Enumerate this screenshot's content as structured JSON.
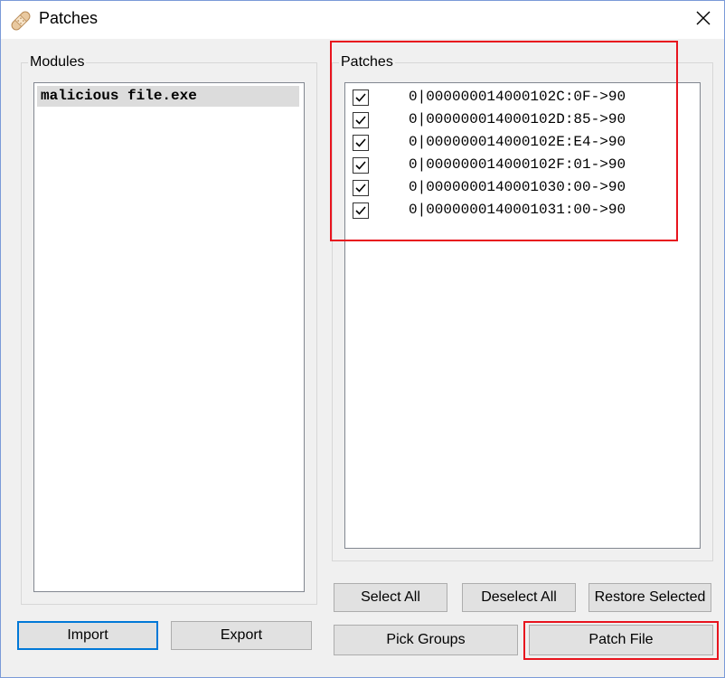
{
  "window": {
    "title": "Patches",
    "title_icon": "bandage-icon",
    "close_icon": "close-icon"
  },
  "modules": {
    "label": "Modules",
    "items": [
      "malicious file.exe"
    ]
  },
  "patches": {
    "label": "Patches",
    "items": [
      {
        "checked": true,
        "text": "0|000000014000102C:0F->90"
      },
      {
        "checked": true,
        "text": "0|000000014000102D:85->90"
      },
      {
        "checked": true,
        "text": "0|000000014000102E:E4->90"
      },
      {
        "checked": true,
        "text": "0|000000014000102F:01->90"
      },
      {
        "checked": true,
        "text": "0|0000000140001030:00->90"
      },
      {
        "checked": true,
        "text": "0|0000000140001031:00->90"
      }
    ]
  },
  "buttons": {
    "select_all": "Select All",
    "deselect_all": "Deselect All",
    "restore_selected": "Restore Selected",
    "import": "Import",
    "export": "Export",
    "pick_groups": "Pick Groups",
    "patch_file": "Patch File"
  },
  "colors": {
    "highlight": "#e8141e",
    "default_button_border": "#0078d7"
  }
}
